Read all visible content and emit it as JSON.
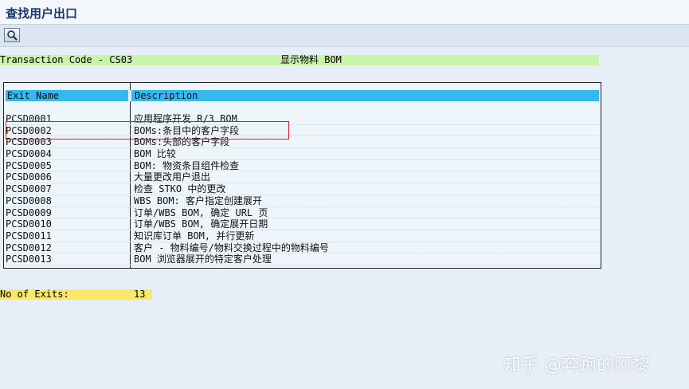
{
  "window": {
    "title": "查找用户出口"
  },
  "toolbar": {
    "zoom_icon": "magnifier-icon"
  },
  "transaction": {
    "code": "Transaction Code - CS03",
    "description": "显示物料 BOM"
  },
  "table": {
    "headers": [
      "Exit Name",
      "Description"
    ],
    "rows": [
      [
        "PCSD0001",
        "应用程序开发 R/3 BOM"
      ],
      [
        "PCSD0002",
        "BOMs:条目中的客户字段"
      ],
      [
        "PCSD0003",
        "BOMs:头部的客户字段"
      ],
      [
        "PCSD0004",
        "BOM 比较"
      ],
      [
        "PCSD0005",
        "BOM: 物资条目组件检查"
      ],
      [
        "PCSD0006",
        "大量更改用户退出"
      ],
      [
        "PCSD0007",
        "检查 STKO 中的更改"
      ],
      [
        "PCSD0008",
        "WBS BOM: 客户指定创建展开"
      ],
      [
        "PCSD0009",
        "订单/WBS BOM, 确定 URL 页"
      ],
      [
        "PCSD0010",
        "订单/WBS BOM, 确定展开日期"
      ],
      [
        "PCSD0011",
        "知识库订单 BOM, 并行更新"
      ],
      [
        "PCSD0012",
        "客户 - 物料编号/物料交换过程中的物料编号"
      ],
      [
        "PCSD0013",
        "BOM 浏览器展开的特定客户处理"
      ]
    ]
  },
  "summary": {
    "label": "No of Exits:",
    "count": "13"
  },
  "watermark": "知乎 @奔跑的阿黎",
  "colors": {
    "header_bg": "#34b8ee",
    "transaction_bg": "#c8f4a8",
    "summary_bg": "#fbe866",
    "highlight_border": "#e0181c"
  }
}
